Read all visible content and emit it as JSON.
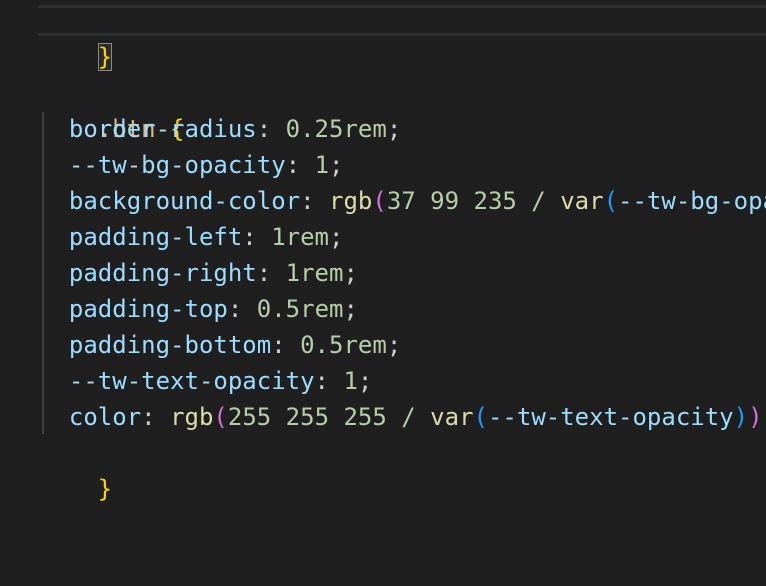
{
  "code": {
    "close_brace_top": "}",
    "selector": ".btn",
    "open_brace": "{",
    "close_brace": "}",
    "lines": [
      {
        "prop": "border-radius",
        "value": "0.25rem"
      },
      {
        "prop": "--tw-bg-opacity",
        "value": "1"
      },
      {
        "prop": "background-color",
        "fn": "rgb",
        "args": "37 99 235 /",
        "inner_fn": "var",
        "inner_arg": "--tw-bg-opa"
      },
      {
        "prop": "padding-left",
        "value": "1rem"
      },
      {
        "prop": "padding-right",
        "value": "1rem"
      },
      {
        "prop": "padding-top",
        "value": "0.5rem"
      },
      {
        "prop": "padding-bottom",
        "value": "0.5rem"
      },
      {
        "prop": "--tw-text-opacity",
        "value": "1"
      },
      {
        "prop": "color",
        "fn": "rgb",
        "args": "255 255 255 /",
        "inner_fn": "var",
        "inner_arg": "--tw-text-opacity"
      }
    ]
  },
  "colors": {
    "background": "#1f1f1f",
    "brace": "#ffd700",
    "selector": "#d7ba7d",
    "property": "#9cdcfe",
    "number": "#b5cea8",
    "function": "#dcdcaa"
  }
}
